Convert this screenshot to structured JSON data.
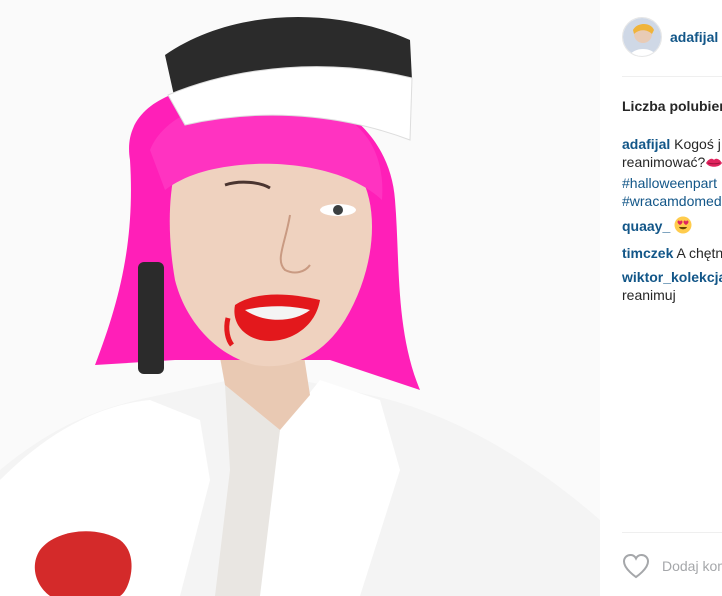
{
  "post": {
    "username": "adafijal",
    "likes_label": "Liczba polubień",
    "caption": {
      "user": "adafijal",
      "line1": "Kogoś j",
      "line2": "reanimować?",
      "tag1": "#halloweenpart",
      "tag2": "#wracamdomed"
    },
    "comments": [
      {
        "user": "quaay_",
        "text": "",
        "emoji": "heart-eyes-emoji"
      },
      {
        "user": "timczek",
        "text": "A chętn"
      },
      {
        "user": "wiktor_kolekcja",
        "text": "reanimuj"
      }
    ],
    "add_comment_placeholder": "Dodaj kom",
    "colors": {
      "link": "#125688",
      "wig": "#ff1fb8",
      "lips": "#e3181c",
      "placeholder": "#a5a7aa"
    }
  }
}
